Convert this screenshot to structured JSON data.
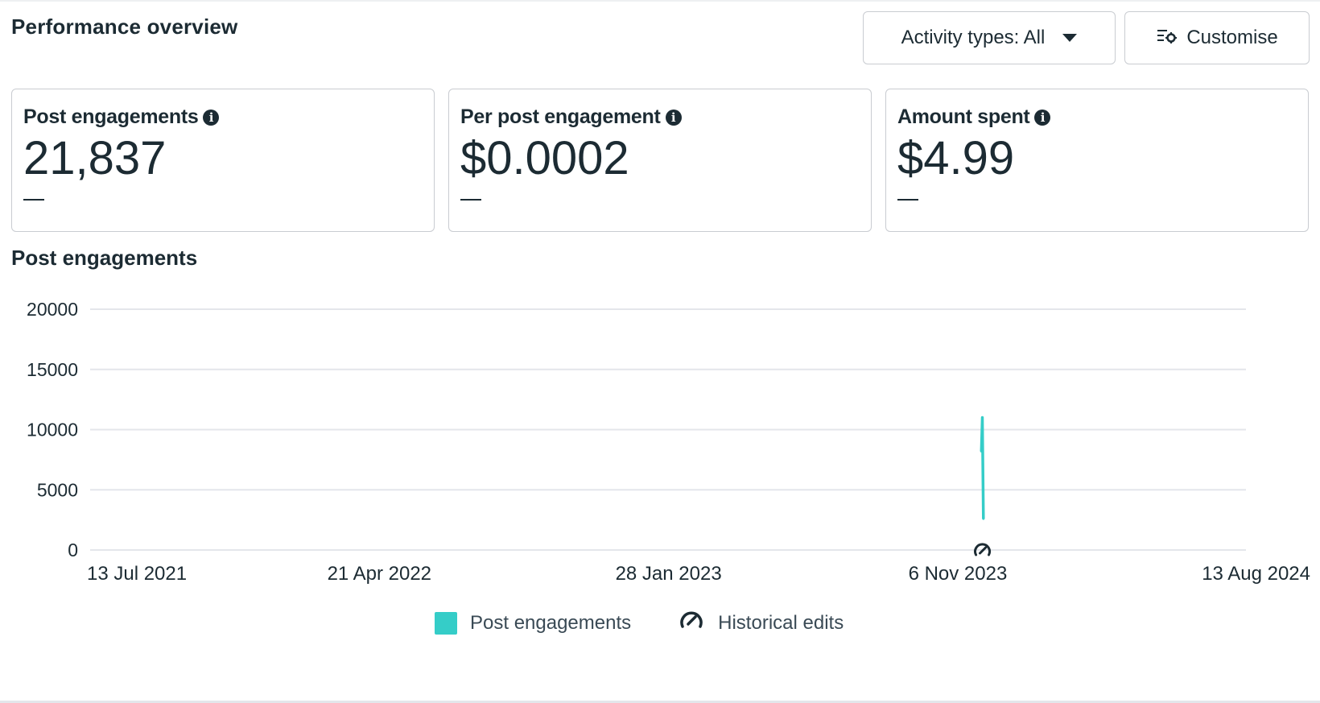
{
  "header": {
    "title": "Performance overview",
    "activity_button": "Activity types: All",
    "customise_button": "Customise"
  },
  "cards": [
    {
      "label": "Post engagements",
      "value": "21,837",
      "change": "—"
    },
    {
      "label": "Per post engagement",
      "value": "$0.0002",
      "change": "—"
    },
    {
      "label": "Amount spent",
      "value": "$4.99",
      "change": "—"
    }
  ],
  "chart_section": {
    "title": "Post engagements"
  },
  "legend": {
    "series_label": "Post engagements",
    "edits_label": "Historical edits"
  },
  "colors": {
    "series": "#35cdc8",
    "grid": "#e4e6eb",
    "text": "#1c2b33"
  },
  "chart_data": {
    "type": "line",
    "title": "Post engagements",
    "x_tick_labels": [
      "13 Jul 2021",
      "21 Apr 2022",
      "28 Jan 2023",
      "6 Nov 2023",
      "13 Aug 2024"
    ],
    "x_tick_dates": [
      "2021-07-13",
      "2022-04-21",
      "2023-01-28",
      "2023-11-06",
      "2024-08-13"
    ],
    "y_ticks": [
      0,
      5000,
      10000,
      15000,
      20000
    ],
    "ylim": [
      0,
      20000
    ],
    "grid": true,
    "legend_position": "bottom-center",
    "series": [
      {
        "name": "Post engagements",
        "x": [
          "2023-11-29",
          "2023-11-30",
          "2023-12-01"
        ],
        "values": [
          8200,
          11000,
          2600
        ]
      }
    ],
    "historical_edits": [
      "2023-11-30"
    ]
  }
}
